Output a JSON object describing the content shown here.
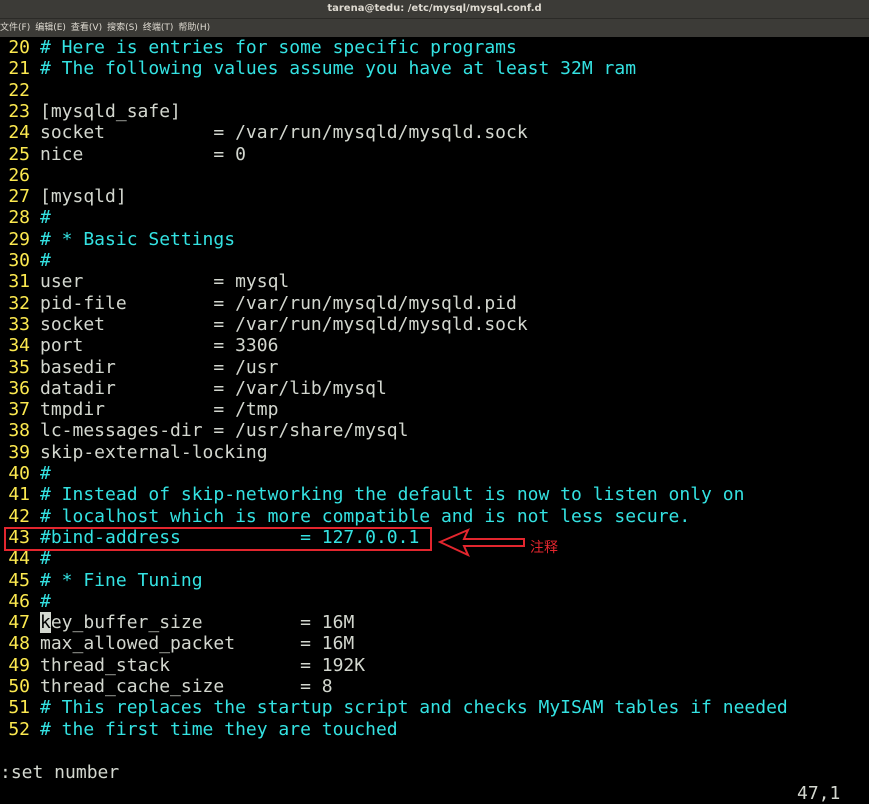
{
  "window": {
    "title": "tarena@tedu: /etc/mysql/mysql.conf.d"
  },
  "menu": [
    "文件(F)",
    "编辑(E)",
    "查看(V)",
    "搜索(S)",
    "终端(T)",
    "帮助(H)"
  ],
  "lines": [
    {
      "n": "20",
      "text": "# Here is entries for some specific programs",
      "type": "comment"
    },
    {
      "n": "21",
      "text": "# The following values assume you have at least 32M ram",
      "type": "comment"
    },
    {
      "n": "22",
      "text": "",
      "type": "text"
    },
    {
      "n": "23",
      "text": "[mysqld_safe]",
      "type": "text"
    },
    {
      "n": "24",
      "text": "socket          = /var/run/mysqld/mysqld.sock",
      "type": "text"
    },
    {
      "n": "25",
      "text": "nice            = 0",
      "type": "text"
    },
    {
      "n": "26",
      "text": "",
      "type": "text"
    },
    {
      "n": "27",
      "text": "[mysqld]",
      "type": "text"
    },
    {
      "n": "28",
      "text": "#",
      "type": "comment"
    },
    {
      "n": "29",
      "text": "# * Basic Settings",
      "type": "comment"
    },
    {
      "n": "30",
      "text": "#",
      "type": "comment"
    },
    {
      "n": "31",
      "text": "user            = mysql",
      "type": "text"
    },
    {
      "n": "32",
      "text": "pid-file        = /var/run/mysqld/mysqld.pid",
      "type": "text"
    },
    {
      "n": "33",
      "text": "socket          = /var/run/mysqld/mysqld.sock",
      "type": "text"
    },
    {
      "n": "34",
      "text": "port            = 3306",
      "type": "text"
    },
    {
      "n": "35",
      "text": "basedir         = /usr",
      "type": "text"
    },
    {
      "n": "36",
      "text": "datadir         = /var/lib/mysql",
      "type": "text"
    },
    {
      "n": "37",
      "text": "tmpdir          = /tmp",
      "type": "text"
    },
    {
      "n": "38",
      "text": "lc-messages-dir = /usr/share/mysql",
      "type": "text"
    },
    {
      "n": "39",
      "text": "skip-external-locking",
      "type": "text"
    },
    {
      "n": "40",
      "text": "#",
      "type": "comment"
    },
    {
      "n": "41",
      "text": "# Instead of skip-networking the default is now to listen only on",
      "type": "comment"
    },
    {
      "n": "42",
      "text": "# localhost which is more compatible and is not less secure.",
      "type": "comment"
    },
    {
      "n": "43",
      "text": "#bind-address           = 127.0.0.1",
      "type": "comment"
    },
    {
      "n": "44",
      "text": "#",
      "type": "comment"
    },
    {
      "n": "45",
      "text": "# * Fine Tuning",
      "type": "comment"
    },
    {
      "n": "46",
      "text": "#",
      "type": "comment"
    },
    {
      "n": "47",
      "text": "key_buffer_size         = 16M",
      "type": "text"
    },
    {
      "n": "48",
      "text": "max_allowed_packet      = 16M",
      "type": "text"
    },
    {
      "n": "49",
      "text": "thread_stack            = 192K",
      "type": "text"
    },
    {
      "n": "50",
      "text": "thread_cache_size       = 8",
      "type": "text"
    },
    {
      "n": "51",
      "text": "# This replaces the startup script and checks MyISAM tables if needed",
      "type": "comment"
    },
    {
      "n": "52",
      "text": "# the first time they are touched",
      "type": "comment"
    }
  ],
  "statusbar": {
    "command": ":set number",
    "position": "47,1"
  },
  "annotation": {
    "label": "注释",
    "color": "#e3262e"
  },
  "colors": {
    "line_number": "#fce94f",
    "comment": "#34e2e2",
    "text": "#d3d7cf",
    "background": "#000000"
  }
}
